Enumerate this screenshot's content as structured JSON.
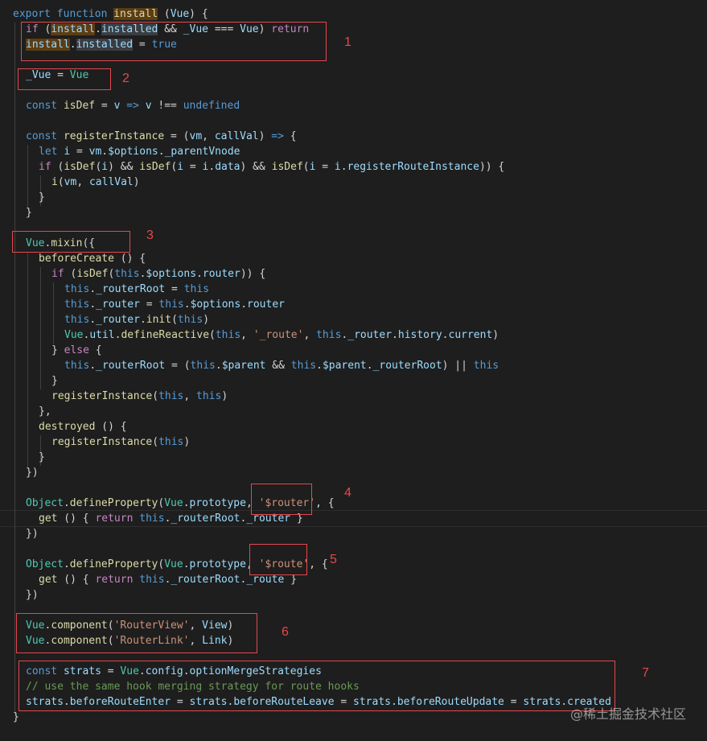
{
  "annotations": [
    "1",
    "2",
    "3",
    "4",
    "5",
    "6",
    "7"
  ],
  "watermark": "@稀土掘金技术社区",
  "code": [
    [
      [
        "export function ",
        "kw"
      ],
      [
        "install",
        "fn hl"
      ],
      [
        " (",
        "op"
      ],
      [
        "Vue",
        "var"
      ],
      [
        ") {",
        "op"
      ]
    ],
    [
      [
        "if",
        "kw2"
      ],
      [
        " (",
        "op"
      ],
      [
        "install",
        "var hl"
      ],
      [
        ".",
        "op"
      ],
      [
        "installed",
        "var hl2"
      ],
      [
        " && ",
        "op"
      ],
      [
        "_Vue",
        "var"
      ],
      [
        " === ",
        "op"
      ],
      [
        "Vue",
        "var"
      ],
      [
        ") ",
        "op"
      ],
      [
        "return",
        "kw2"
      ]
    ],
    [
      [
        "install",
        "var hl"
      ],
      [
        ".",
        "op"
      ],
      [
        "installed",
        "var hl2"
      ],
      [
        " = ",
        "op"
      ],
      [
        "true",
        "kw"
      ]
    ],
    [],
    [
      [
        "_Vue",
        "var"
      ],
      [
        " = ",
        "op"
      ],
      [
        "Vue",
        "cls"
      ]
    ],
    [],
    [
      [
        "const ",
        "kw"
      ],
      [
        "isDef",
        "fn"
      ],
      [
        " = ",
        "op"
      ],
      [
        "v",
        "var"
      ],
      [
        " => ",
        "kw"
      ],
      [
        "v",
        "var"
      ],
      [
        " !== ",
        "op"
      ],
      [
        "undefined",
        "kw"
      ]
    ],
    [],
    [
      [
        "const ",
        "kw"
      ],
      [
        "registerInstance",
        "fn"
      ],
      [
        " = (",
        "op"
      ],
      [
        "vm",
        "var"
      ],
      [
        ", ",
        "op"
      ],
      [
        "callVal",
        "var"
      ],
      [
        ") ",
        "op"
      ],
      [
        "=>",
        "kw"
      ],
      [
        " {",
        "op"
      ]
    ],
    [
      [
        "let ",
        "kw"
      ],
      [
        "i",
        "var"
      ],
      [
        " = ",
        "op"
      ],
      [
        "vm",
        "var"
      ],
      [
        ".",
        "op"
      ],
      [
        "$options",
        "var"
      ],
      [
        ".",
        "op"
      ],
      [
        "_parentVnode",
        "var"
      ]
    ],
    [
      [
        "if",
        "kw2"
      ],
      [
        " (",
        "op"
      ],
      [
        "isDef",
        "fn"
      ],
      [
        "(",
        "op"
      ],
      [
        "i",
        "var"
      ],
      [
        ") && ",
        "op"
      ],
      [
        "isDef",
        "fn"
      ],
      [
        "(",
        "op"
      ],
      [
        "i",
        "var"
      ],
      [
        " = ",
        "op"
      ],
      [
        "i",
        "var"
      ],
      [
        ".",
        "op"
      ],
      [
        "data",
        "var"
      ],
      [
        ") && ",
        "op"
      ],
      [
        "isDef",
        "fn"
      ],
      [
        "(",
        "op"
      ],
      [
        "i",
        "var"
      ],
      [
        " = ",
        "op"
      ],
      [
        "i",
        "var"
      ],
      [
        ".",
        "op"
      ],
      [
        "registerRouteInstance",
        "var"
      ],
      [
        ")) {",
        "op"
      ]
    ],
    [
      [
        "i",
        "fn"
      ],
      [
        "(",
        "op"
      ],
      [
        "vm",
        "var"
      ],
      [
        ", ",
        "op"
      ],
      [
        "callVal",
        "var"
      ],
      [
        ")",
        "op"
      ]
    ],
    [
      [
        "}",
        "op"
      ]
    ],
    [
      [
        "}",
        "op"
      ]
    ],
    [],
    [
      [
        "Vue",
        "cls"
      ],
      [
        ".",
        "op"
      ],
      [
        "mixin",
        "fn"
      ],
      [
        "({",
        "op"
      ]
    ],
    [
      [
        "beforeCreate",
        "fn"
      ],
      [
        " () {",
        "op"
      ]
    ],
    [
      [
        "if",
        "kw2"
      ],
      [
        " (",
        "op"
      ],
      [
        "isDef",
        "fn"
      ],
      [
        "(",
        "op"
      ],
      [
        "this",
        "kw"
      ],
      [
        ".",
        "op"
      ],
      [
        "$options",
        "var"
      ],
      [
        ".",
        "op"
      ],
      [
        "router",
        "var"
      ],
      [
        ")) {",
        "op"
      ]
    ],
    [
      [
        "this",
        "kw"
      ],
      [
        ".",
        "op"
      ],
      [
        "_routerRoot",
        "var"
      ],
      [
        " = ",
        "op"
      ],
      [
        "this",
        "kw"
      ]
    ],
    [
      [
        "this",
        "kw"
      ],
      [
        ".",
        "op"
      ],
      [
        "_router",
        "var"
      ],
      [
        " = ",
        "op"
      ],
      [
        "this",
        "kw"
      ],
      [
        ".",
        "op"
      ],
      [
        "$options",
        "var"
      ],
      [
        ".",
        "op"
      ],
      [
        "router",
        "var"
      ]
    ],
    [
      [
        "this",
        "kw"
      ],
      [
        ".",
        "op"
      ],
      [
        "_router",
        "var"
      ],
      [
        ".",
        "op"
      ],
      [
        "init",
        "fn"
      ],
      [
        "(",
        "op"
      ],
      [
        "this",
        "kw"
      ],
      [
        ")",
        "op"
      ]
    ],
    [
      [
        "Vue",
        "cls"
      ],
      [
        ".",
        "op"
      ],
      [
        "util",
        "var"
      ],
      [
        ".",
        "op"
      ],
      [
        "defineReactive",
        "fn"
      ],
      [
        "(",
        "op"
      ],
      [
        "this",
        "kw"
      ],
      [
        ", ",
        "op"
      ],
      [
        "'_route'",
        "str"
      ],
      [
        ", ",
        "op"
      ],
      [
        "this",
        "kw"
      ],
      [
        ".",
        "op"
      ],
      [
        "_router",
        "var"
      ],
      [
        ".",
        "op"
      ],
      [
        "history",
        "var"
      ],
      [
        ".",
        "op"
      ],
      [
        "current",
        "var"
      ],
      [
        ")",
        "op"
      ]
    ],
    [
      [
        "} ",
        "op"
      ],
      [
        "else",
        "kw2"
      ],
      [
        " {",
        "op"
      ]
    ],
    [
      [
        "this",
        "kw"
      ],
      [
        ".",
        "op"
      ],
      [
        "_routerRoot",
        "var"
      ],
      [
        " = (",
        "op"
      ],
      [
        "this",
        "kw"
      ],
      [
        ".",
        "op"
      ],
      [
        "$parent",
        "var"
      ],
      [
        " && ",
        "op"
      ],
      [
        "this",
        "kw"
      ],
      [
        ".",
        "op"
      ],
      [
        "$parent",
        "var"
      ],
      [
        ".",
        "op"
      ],
      [
        "_routerRoot",
        "var"
      ],
      [
        ") || ",
        "op"
      ],
      [
        "this",
        "kw"
      ]
    ],
    [
      [
        "}",
        "op"
      ]
    ],
    [
      [
        "registerInstance",
        "fn"
      ],
      [
        "(",
        "op"
      ],
      [
        "this",
        "kw"
      ],
      [
        ", ",
        "op"
      ],
      [
        "this",
        "kw"
      ],
      [
        ")",
        "op"
      ]
    ],
    [
      [
        "},",
        "op"
      ]
    ],
    [
      [
        "destroyed",
        "fn"
      ],
      [
        " () {",
        "op"
      ]
    ],
    [
      [
        "registerInstance",
        "fn"
      ],
      [
        "(",
        "op"
      ],
      [
        "this",
        "kw"
      ],
      [
        ")",
        "op"
      ]
    ],
    [
      [
        "}",
        "op"
      ]
    ],
    [
      [
        "})",
        "op"
      ]
    ],
    [],
    [
      [
        "Object",
        "cls"
      ],
      [
        ".",
        "op"
      ],
      [
        "defineProperty",
        "fn"
      ],
      [
        "(",
        "op"
      ],
      [
        "Vue",
        "cls"
      ],
      [
        ".",
        "op"
      ],
      [
        "prototype",
        "var"
      ],
      [
        ", ",
        "op"
      ],
      [
        "'$router'",
        "str"
      ],
      [
        ", {",
        "op"
      ]
    ],
    [
      [
        "get",
        "fn"
      ],
      [
        " () { ",
        "op"
      ],
      [
        "return",
        "kw2"
      ],
      [
        " ",
        "op"
      ],
      [
        "this",
        "kw"
      ],
      [
        ".",
        "op"
      ],
      [
        "_routerRoot",
        "var"
      ],
      [
        ".",
        "op"
      ],
      [
        "_router",
        "var"
      ],
      [
        " }",
        "op"
      ]
    ],
    [
      [
        "})",
        "op"
      ]
    ],
    [],
    [
      [
        "Object",
        "cls"
      ],
      [
        ".",
        "op"
      ],
      [
        "defineProperty",
        "fn"
      ],
      [
        "(",
        "op"
      ],
      [
        "Vue",
        "cls"
      ],
      [
        ".",
        "op"
      ],
      [
        "prototype",
        "var"
      ],
      [
        ", ",
        "op"
      ],
      [
        "'$route'",
        "str"
      ],
      [
        ", {",
        "op"
      ]
    ],
    [
      [
        "get",
        "fn"
      ],
      [
        " () { ",
        "op"
      ],
      [
        "return",
        "kw2"
      ],
      [
        " ",
        "op"
      ],
      [
        "this",
        "kw"
      ],
      [
        ".",
        "op"
      ],
      [
        "_routerRoot",
        "var"
      ],
      [
        ".",
        "op"
      ],
      [
        "_route",
        "var"
      ],
      [
        " }",
        "op"
      ]
    ],
    [
      [
        "})",
        "op"
      ]
    ],
    [],
    [
      [
        "Vue",
        "cls"
      ],
      [
        ".",
        "op"
      ],
      [
        "component",
        "fn"
      ],
      [
        "(",
        "op"
      ],
      [
        "'RouterView'",
        "str"
      ],
      [
        ", ",
        "op"
      ],
      [
        "View",
        "var"
      ],
      [
        ")",
        "op"
      ]
    ],
    [
      [
        "Vue",
        "cls"
      ],
      [
        ".",
        "op"
      ],
      [
        "component",
        "fn"
      ],
      [
        "(",
        "op"
      ],
      [
        "'RouterLink'",
        "str"
      ],
      [
        ", ",
        "op"
      ],
      [
        "Link",
        "var"
      ],
      [
        ")",
        "op"
      ]
    ],
    [],
    [
      [
        "const ",
        "kw"
      ],
      [
        "strats",
        "var"
      ],
      [
        " = ",
        "op"
      ],
      [
        "Vue",
        "cls"
      ],
      [
        ".",
        "op"
      ],
      [
        "config",
        "var"
      ],
      [
        ".",
        "op"
      ],
      [
        "optionMergeStrategies",
        "var"
      ]
    ],
    [
      [
        "// use the same hook merging strategy for route hooks",
        "cm"
      ]
    ],
    [
      [
        "strats",
        "var"
      ],
      [
        ".",
        "op"
      ],
      [
        "beforeRouteEnter",
        "var"
      ],
      [
        " = ",
        "op"
      ],
      [
        "strats",
        "var"
      ],
      [
        ".",
        "op"
      ],
      [
        "beforeRouteLeave",
        "var"
      ],
      [
        " = ",
        "op"
      ],
      [
        "strats",
        "var"
      ],
      [
        ".",
        "op"
      ],
      [
        "beforeRouteUpdate",
        "var"
      ],
      [
        " = ",
        "op"
      ],
      [
        "strats",
        "var"
      ],
      [
        ".",
        "op"
      ],
      [
        "created",
        "var"
      ]
    ],
    [
      [
        "}",
        "op"
      ]
    ]
  ]
}
